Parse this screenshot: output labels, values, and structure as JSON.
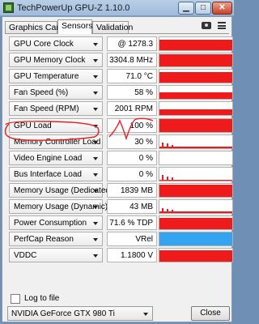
{
  "window": {
    "title": "TechPowerUp GPU-Z 1.10.0",
    "app_icon": "gpu-z-icon"
  },
  "tabs": [
    {
      "label": "Graphics Card"
    },
    {
      "label": "Sensors"
    },
    {
      "label": "Validation"
    }
  ],
  "active_tab": "Sensors",
  "toolbar_icons": [
    "camera-icon",
    "menu-icon"
  ],
  "sensors": [
    {
      "name": "GPU Core Clock",
      "value": "@ 1278.3",
      "level": 0.8
    },
    {
      "name": "GPU Memory Clock",
      "value": "3304.8 MHz",
      "level": 0.95
    },
    {
      "name": "GPU Temperature",
      "value": "71.0 °C",
      "level": 0.8
    },
    {
      "name": "Fan Speed (%)",
      "value": "58 %",
      "level": 0.55
    },
    {
      "name": "Fan Speed (RPM)",
      "value": "2001 RPM",
      "level": 0.45
    },
    {
      "name": "GPU Load",
      "value": "100 %",
      "level": 0.95
    },
    {
      "name": "Memory Controller Load",
      "value": "30 %",
      "level": 0.1
    },
    {
      "name": "Video Engine Load",
      "value": "0 %",
      "level": 0
    },
    {
      "name": "Bus Interface Load",
      "value": "0 %",
      "level": 0.05
    },
    {
      "name": "Memory Usage (Dedicated)",
      "value": "1839 MB",
      "level": 0.95
    },
    {
      "name": "Memory Usage (Dynamic)",
      "value": "43 MB",
      "level": 0.15
    },
    {
      "name": "Power Consumption",
      "value": "71.6 % TDP",
      "level": 0.9
    },
    {
      "name": "PerfCap Reason",
      "value": "VRel",
      "level": 1.0,
      "color": "#35a4f0"
    },
    {
      "name": "VDDC",
      "value": "1.1800 V",
      "level": 0.9
    }
  ],
  "colors": {
    "graph_fill": "#ef1b1b",
    "perfcap_fill": "#35a4f0",
    "annotation": "#e62020"
  },
  "log_to_file": {
    "label": "Log to file",
    "checked": false
  },
  "gpu_selector": {
    "value": "NVIDIA GeForce GTX 980 Ti"
  },
  "close_label": "Close"
}
